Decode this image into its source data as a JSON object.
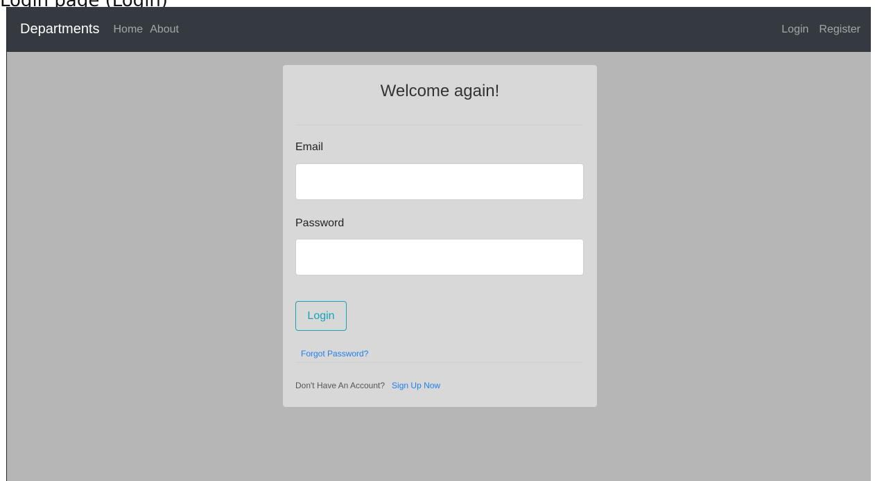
{
  "caption": "Login page (Login)",
  "navbar": {
    "brand": "Departments",
    "links": [
      "Home",
      "About"
    ],
    "right_links": [
      "Login",
      "Register"
    ]
  },
  "card": {
    "title": "Welcome again!",
    "email_label": "Email",
    "email_value": "",
    "password_label": "Password",
    "password_value": "",
    "login_button": "Login",
    "forgot_password": "Forgot Password?",
    "no_account_text": "Don't Have An Account?",
    "signup_link": "Sign Up Now"
  },
  "colors": {
    "navbar_bg": "#343a40",
    "page_bg": "#b6b6b6",
    "card_bg": "#d8d8d8",
    "accent": "#17a2b8",
    "link": "#1f7ff0"
  }
}
